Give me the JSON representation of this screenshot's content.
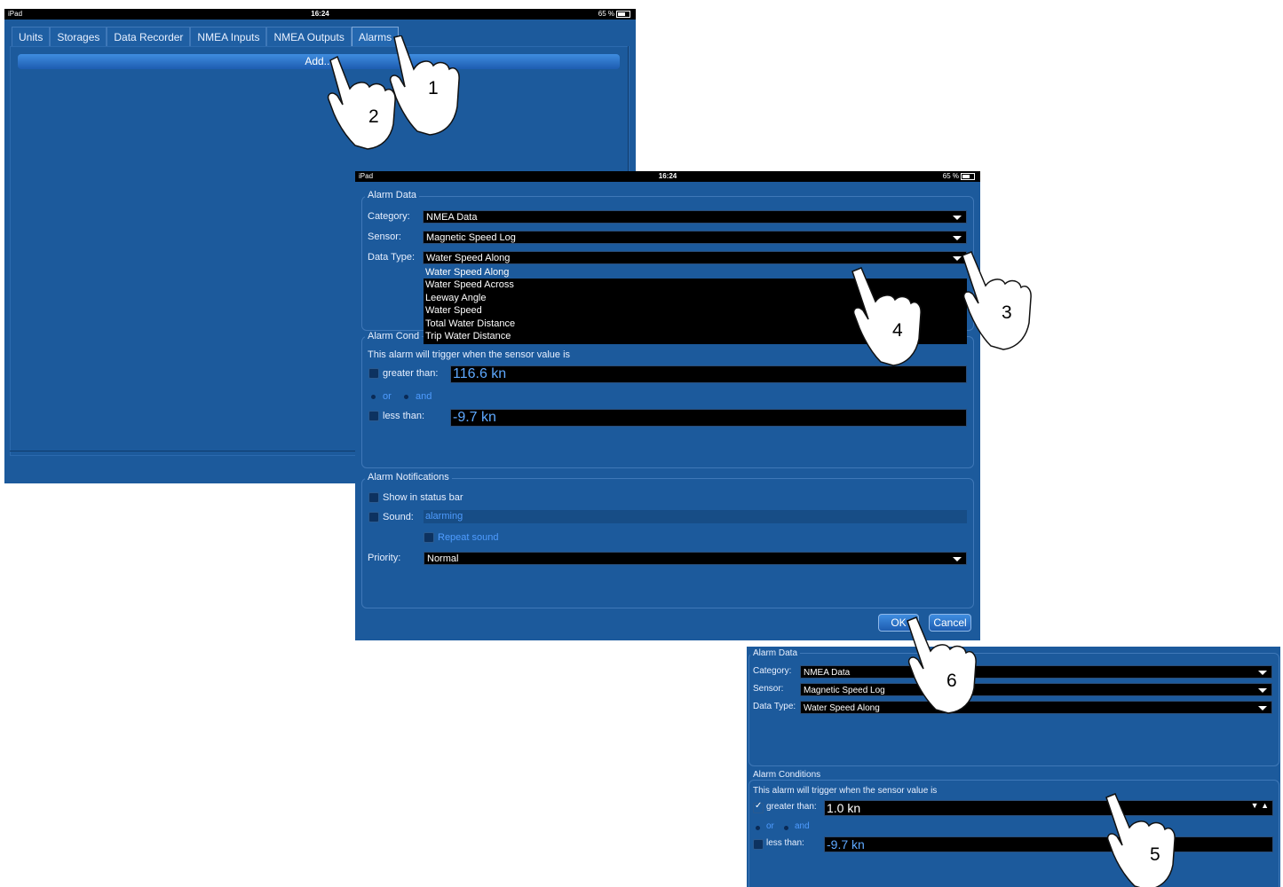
{
  "status": {
    "device": "iPad",
    "time": "16:24",
    "battery": "65 %"
  },
  "screen1": {
    "tabs": [
      "Units",
      "Storages",
      "Data Recorder",
      "NMEA Inputs",
      "NMEA Outputs",
      "Alarms"
    ],
    "active_tab": "Alarms",
    "add_label": "Add..."
  },
  "screen2": {
    "alarm_data": {
      "legend": "Alarm Data",
      "category_label": "Category:",
      "category_value": "NMEA Data",
      "sensor_label": "Sensor:",
      "sensor_value": "Magnetic Speed Log",
      "datatype_label": "Data Type:",
      "datatype_value": "Water Speed Along",
      "datatype_options": [
        "Water Speed Along",
        "Water Speed Across",
        "Leeway Angle",
        "Water Speed",
        "Total Water Distance",
        "Trip Water Distance"
      ]
    },
    "alarm_conditions": {
      "legend": "Alarm Cond",
      "intro": "This alarm will trigger when the sensor value is",
      "greater_label": "greater than:",
      "greater_value": "116.6 kn",
      "or_label": "or",
      "and_label": "and",
      "less_label": "less than:",
      "less_value": "-9.7 kn"
    },
    "alarm_notifications": {
      "legend": "Alarm Notifications",
      "status_bar_label": "Show in status bar",
      "sound_label": "Sound:",
      "sound_value": "alarming",
      "repeat_label": "Repeat sound",
      "priority_label": "Priority:",
      "priority_value": "Normal"
    },
    "ok_label": "OK",
    "cancel_label": "Cancel"
  },
  "screen3": {
    "alarm_data": {
      "legend": "Alarm Data",
      "category_label": "Category:",
      "category_value": "NMEA Data",
      "sensor_label": "Sensor:",
      "sensor_value": "Magnetic Speed Log",
      "datatype_label": "Data Type:",
      "datatype_value": "Water Speed Along"
    },
    "alarm_conditions": {
      "legend": "Alarm Conditions",
      "intro": "This alarm will trigger when the sensor value is",
      "greater_label": "greater than:",
      "greater_value": "1.0 kn",
      "or_label": "or",
      "and_label": "and",
      "less_label": "less than:",
      "less_value": "-9.7 kn"
    }
  },
  "steps": [
    "1",
    "2",
    "3",
    "4",
    "5",
    "6"
  ]
}
